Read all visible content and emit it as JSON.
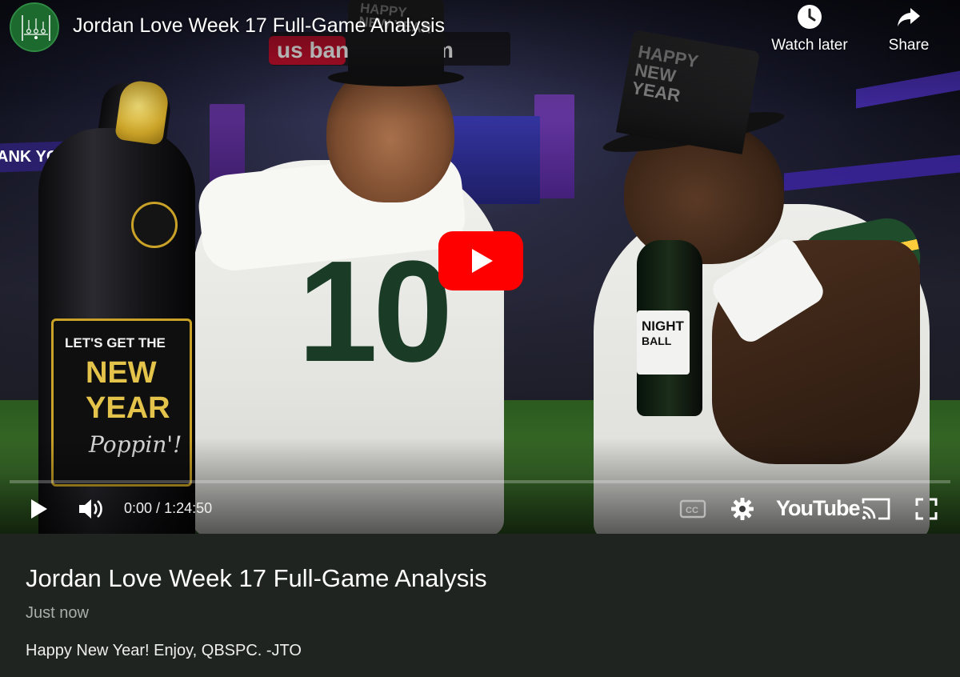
{
  "channel": {
    "avatar_icon": "football-playbook-logo"
  },
  "video": {
    "title": "Jordan Love Week 17 Full-Game Analysis",
    "thumbnail_text": {
      "hat_left": "HAPPY NEW YEAR",
      "hat_right": "HAPPY NEW YEAR",
      "bottle_label_1": "LET'S GET THE",
      "bottle_label_2": "NEW",
      "bottle_label_3": "YEAR",
      "bottle_label_4": "Poppin'!",
      "small_bottle_label_1": "NIGHT",
      "small_bottle_label_2": "BALL",
      "stadium_sign": "us bank stadium",
      "banner_left": "ANK YOU",
      "jersey_number": "10"
    }
  },
  "top_actions": {
    "watch_later": {
      "label": "Watch later",
      "icon": "clock-icon"
    },
    "share": {
      "label": "Share",
      "icon": "share-arrow-icon"
    }
  },
  "player_controls": {
    "time_current": "0:00",
    "time_separator": " / ",
    "time_total": "1:24:50",
    "progress_fraction": 0,
    "logo_text": "YouTube",
    "icons": [
      "play-icon",
      "volume-icon",
      "cc-icon",
      "settings-gear-icon",
      "cast-icon",
      "fullscreen-icon"
    ],
    "accent_color": "#ff0000"
  },
  "info": {
    "title": "Jordan Love Week 17 Full-Game Analysis",
    "date": "Just now",
    "description": "Happy New Year! Enjoy, QBSPC. -JTO"
  }
}
